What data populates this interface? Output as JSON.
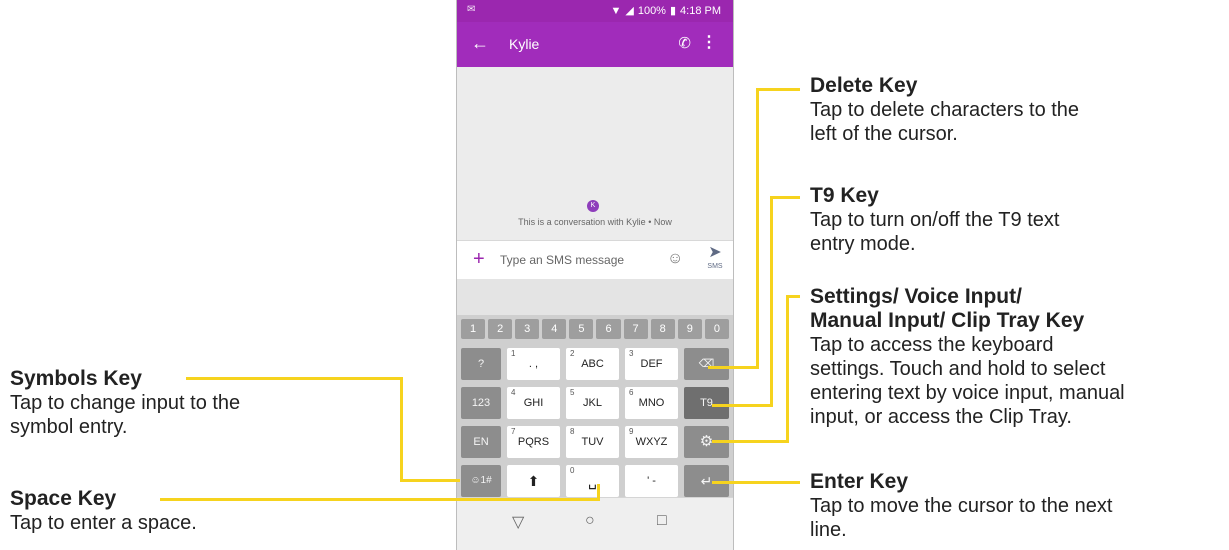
{
  "status_bar": {
    "battery": "100%",
    "time": "4:18 PM"
  },
  "app_bar": {
    "title": "Kylie",
    "back_icon": "arrow-left-icon",
    "call_icon": "phone-icon",
    "more_icon": "more-vert-icon"
  },
  "conversation": {
    "avatar_letter": "K",
    "info": "This is a conversation with Kylie • Now"
  },
  "composer": {
    "placeholder": "Type an SMS message",
    "send_sub": "SMS"
  },
  "keyboard": {
    "numbers": [
      "1",
      "2",
      "3",
      "4",
      "5",
      "6",
      "7",
      "8",
      "9",
      "0"
    ],
    "row1": {
      "sym": "?",
      "k1_sup": "1",
      "k1": ". ,",
      "k2_sup": "2",
      "k2": "ABC",
      "k3_sup": "3",
      "k3": "DEF"
    },
    "row2": {
      "left": "123",
      "k1_sup": "4",
      "k1": "GHI",
      "k2_sup": "5",
      "k2": "JKL",
      "k3_sup": "6",
      "k3": "MNO",
      "right": "T9"
    },
    "row3": {
      "left": "EN",
      "k1_sup": "7",
      "k1": "PQRS",
      "k2_sup": "8",
      "k2": "TUV",
      "k3_sup": "9",
      "k3": "WXYZ"
    },
    "row4": {
      "left": "☺1#",
      "space_sup": "0",
      "punct": "' -"
    }
  },
  "callouts": {
    "delete": {
      "title": "Delete Key",
      "lines": [
        "Tap to delete characters to the",
        "left of the cursor."
      ]
    },
    "t9": {
      "title": "T9 Key",
      "lines": [
        "Tap to turn on/off the T9 text",
        "entry mode."
      ]
    },
    "settings": {
      "title1": "Settings/ Voice Input/",
      "title2": "Manual Input/ Clip Tray Key",
      "lines": [
        "Tap to access the keyboard",
        "settings. Touch and hold to select",
        "entering text by voice input, manual",
        "input, or access the Clip Tray."
      ]
    },
    "enter": {
      "title": "Enter Key",
      "lines": [
        "Tap to move the cursor to the next",
        "line."
      ]
    },
    "symbols": {
      "title": "Symbols Key",
      "lines": [
        "Tap to change input to the",
        "symbol entry."
      ]
    },
    "space": {
      "title": "Space Key",
      "lines": [
        "Tap to enter a space."
      ]
    }
  },
  "colors": {
    "brand_purple": "#9b27af",
    "callout_yellow": "#f6d31e"
  }
}
